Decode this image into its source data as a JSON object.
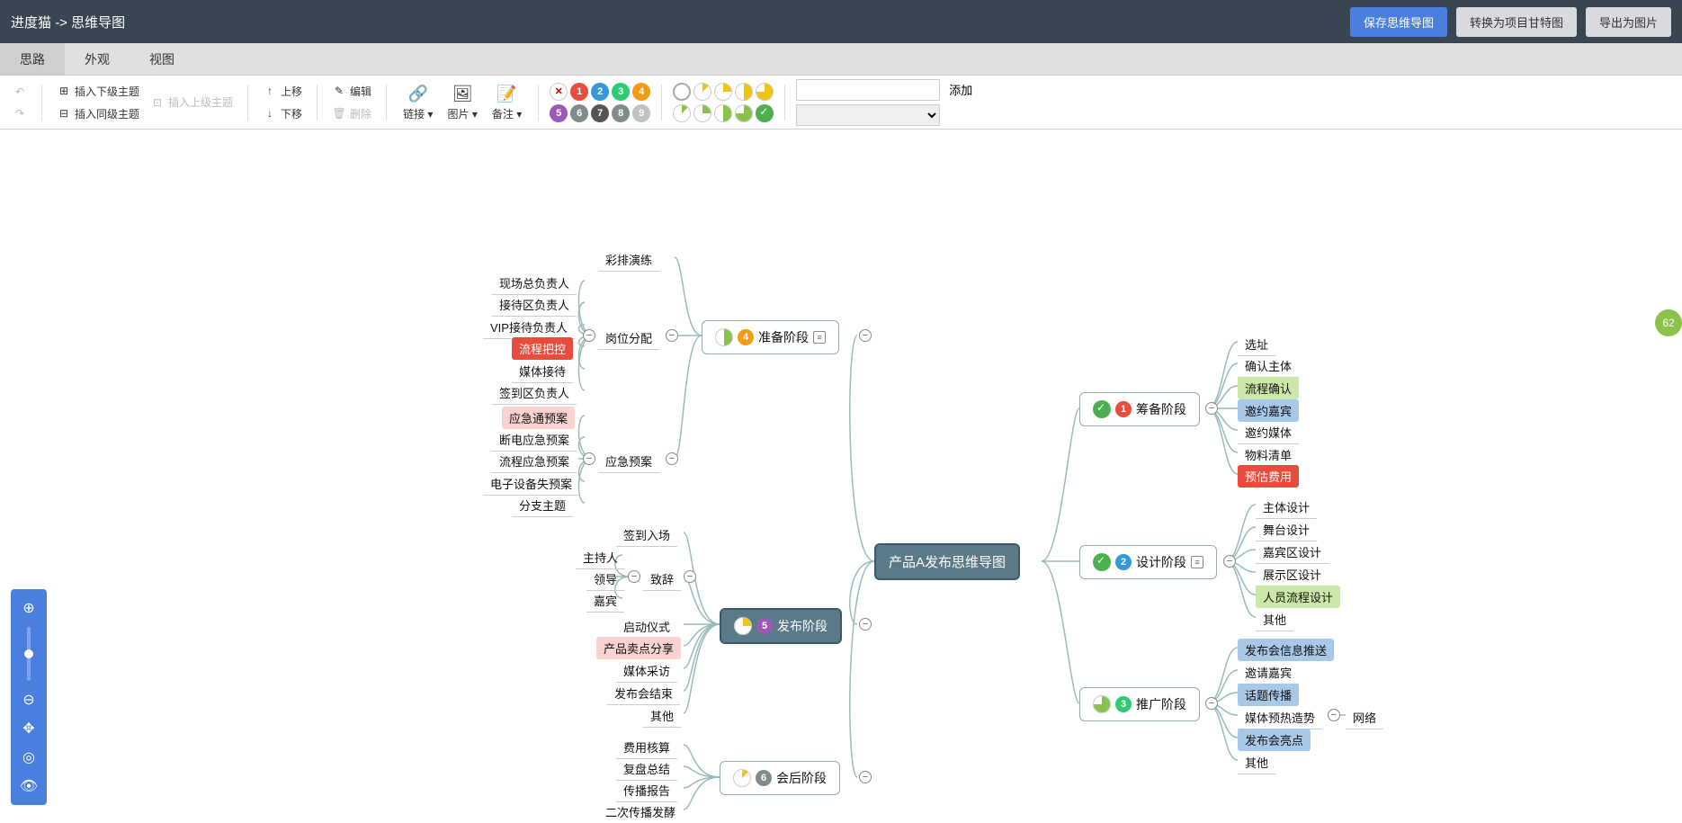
{
  "header": {
    "breadcrumb_app": "进度猫",
    "breadcrumb_sep": "->",
    "breadcrumb_page": "思维导图",
    "btn_save": "保存思维导图",
    "btn_convert": "转换为项目甘特图",
    "btn_export": "导出为图片"
  },
  "tabs": {
    "t0": "思路",
    "t1": "外观",
    "t2": "视图"
  },
  "toolbar": {
    "insert_child": "插入下级主题",
    "insert_sibling": "插入同级主题",
    "insert_parent": "插入上级主题",
    "move_up": "上移",
    "move_down": "下移",
    "edit": "编辑",
    "delete": "删除",
    "link": "链接",
    "image": "图片",
    "note": "备注",
    "add": "添加",
    "dropdown_caret": "▾"
  },
  "root": {
    "label": "产品A发布思维导图"
  },
  "right": {
    "stage1": {
      "label": "筹备阶段",
      "num": "1",
      "c0": "选址",
      "c1": "确认主体",
      "c2": "流程确认",
      "c3": "邀约嘉宾",
      "c4": "邀约媒体",
      "c5": "物料清单",
      "c6": "预估费用"
    },
    "stage2": {
      "label": "设计阶段",
      "num": "2",
      "c0": "主体设计",
      "c1": "舞台设计",
      "c2": "嘉宾区设计",
      "c3": "展示区设计",
      "c4": "人员流程设计",
      "c5": "其他"
    },
    "stage3": {
      "label": "推广阶段",
      "num": "3",
      "c0": "发布会信息推送",
      "c1": "邀请嘉宾",
      "c2": "话题传播",
      "c3": "媒体预热造势",
      "c3b": "网络",
      "c4": "发布会亮点",
      "c5": "其他"
    }
  },
  "left": {
    "stage4": {
      "label": "准备阶段",
      "num": "4",
      "rehearsal": "彩排演练",
      "posts": {
        "label": "岗位分配",
        "c0": "现场总负责人",
        "c1": "接待区负责人",
        "c2": "VIP接待负责人",
        "c3": "流程把控",
        "c4": "媒体接待",
        "c5": "签到区负责人"
      },
      "contingency": {
        "label": "应急预案",
        "c0": "应急通预案",
        "c1": "断电应急预案",
        "c2": "流程应急预案",
        "c3": "电子设备失预案",
        "c4": "分支主题"
      }
    },
    "stage5": {
      "label": "发布阶段",
      "num": "5",
      "signin": "签到入场",
      "speech": {
        "label": "致辞",
        "c0": "主持人",
        "c1": "领导",
        "c2": "嘉宾"
      },
      "c2": "启动仪式",
      "c3": "产品卖点分享",
      "c4": "媒体采访",
      "c5": "发布会结束",
      "c6": "其他"
    },
    "stage6": {
      "label": "会后阶段",
      "num": "6",
      "c0": "费用核算",
      "c1": "复盘总结",
      "c2": "传播报告",
      "c3": "二次传播发酵"
    }
  },
  "float_badge": "62"
}
